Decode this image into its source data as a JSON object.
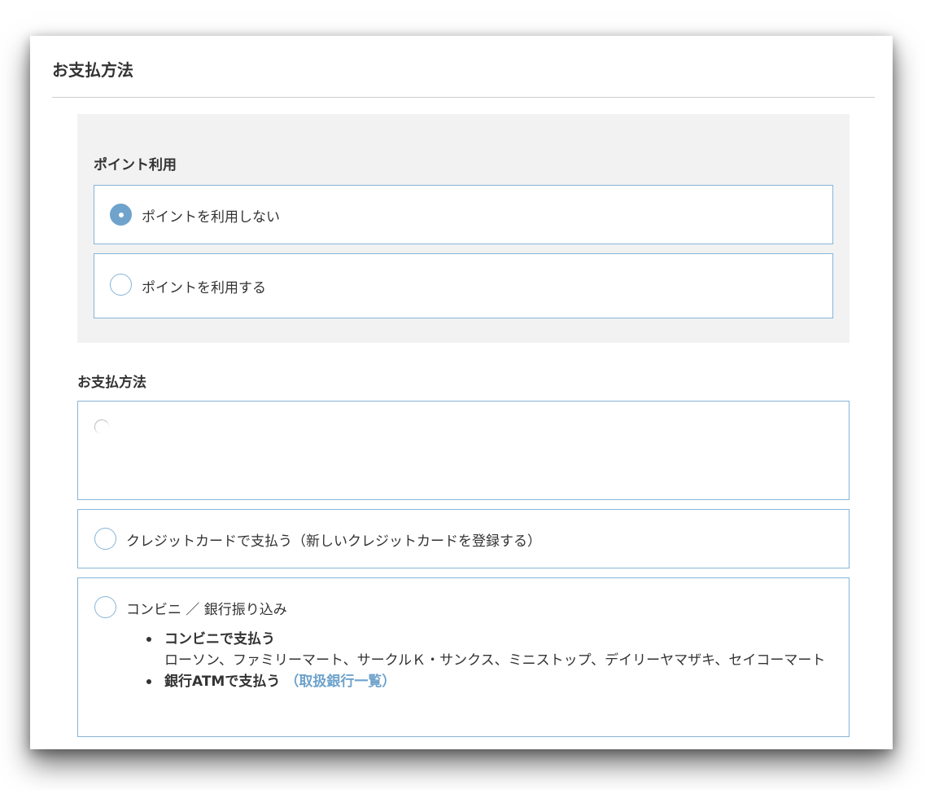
{
  "page": {
    "title": "お支払方法"
  },
  "points": {
    "heading": "ポイント利用",
    "options": [
      {
        "label": "ポイントを利用しない",
        "selected": true
      },
      {
        "label": "ポイントを利用する",
        "selected": false
      }
    ]
  },
  "payment": {
    "heading": "お支払方法",
    "credit_card": {
      "label": "クレジットカードで支払う（新しいクレジットカードを登録する）",
      "selected": false
    },
    "konbini": {
      "label": "コンビニ ／ 銀行振り込み",
      "selected": false,
      "items": [
        {
          "title": "コンビニで支払う",
          "desc": "ローソン、ファミリーマート、サークルＫ・サンクス、ミニストップ、デイリーヤマザキ、セイコーマート"
        },
        {
          "title": "銀行ATMで支払う",
          "link": "（取扱銀行一覧）"
        }
      ]
    }
  },
  "colors": {
    "accent": "#6fa3cc",
    "border": "#87b5d6",
    "panel_bg": "#f2f2f2"
  }
}
